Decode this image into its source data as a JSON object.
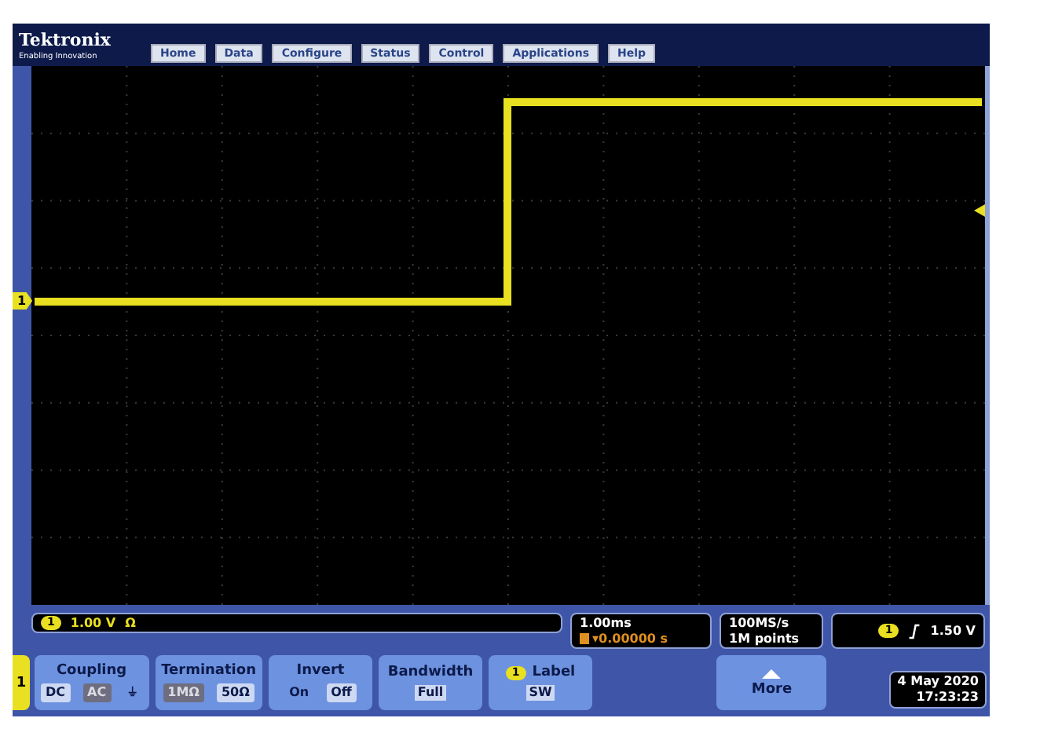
{
  "header": {
    "brand": "Tektronix",
    "tagline": "Enabling Innovation"
  },
  "tabs": [
    {
      "label": "Home",
      "selected": false
    },
    {
      "label": "Data",
      "selected": false
    },
    {
      "label": "Configure",
      "selected": false
    },
    {
      "label": "Status",
      "selected": false
    },
    {
      "label": "Control",
      "selected": false
    },
    {
      "label": "Applications",
      "selected": false
    },
    {
      "label": "Help",
      "selected": false
    }
  ],
  "graticule": {
    "channel_marker": "1"
  },
  "vertical_readout": {
    "channel": "1",
    "scale": "1.00 V",
    "termination_symbol": "Ω"
  },
  "horizontal_readout": {
    "scale": "1.00ms",
    "trigger_position": "▾0.00000 s"
  },
  "acquisition_readout": {
    "sample_rate": "100MS/s",
    "record_length": "1M points"
  },
  "trigger_readout": {
    "channel": "1",
    "level": "1.50 V"
  },
  "channel_tab": "1",
  "menu": [
    {
      "kind": "options",
      "title": "Coupling",
      "options": [
        {
          "label": "DC",
          "selected": true,
          "disabled": false
        },
        {
          "label": "AC",
          "selected": false,
          "disabled": true
        },
        {
          "label": "⏚",
          "selected": false,
          "disabled": false
        }
      ]
    },
    {
      "kind": "options",
      "title": "Termination",
      "options": [
        {
          "label": "1MΩ",
          "selected": false,
          "disabled": true
        },
        {
          "label": "50Ω",
          "selected": true,
          "disabled": false
        }
      ]
    },
    {
      "kind": "options",
      "title": "Invert",
      "options": [
        {
          "label": "On",
          "selected": false,
          "disabled": false
        },
        {
          "label": "Off",
          "selected": true,
          "disabled": false
        }
      ]
    },
    {
      "kind": "value",
      "title": "Bandwidth",
      "value": "Full"
    },
    {
      "kind": "label",
      "badge": "1",
      "title": "Label",
      "value": "SW"
    }
  ],
  "more_button": "More",
  "datetime": {
    "date": "4 May 2020",
    "time": "17:23:23"
  }
}
